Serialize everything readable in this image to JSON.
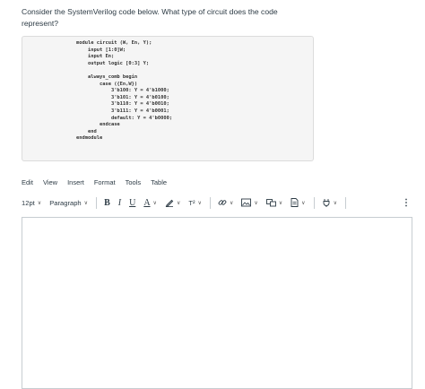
{
  "question": {
    "line1": "Consider the SystemVerilog code below. What type of circuit does the code",
    "line2": "represent?"
  },
  "code_lines": [
    "module circuit (W, En, Y);",
    "    input [1:0]W;",
    "    input En;",
    "    output logic [0:3] Y;",
    "",
    "    always_comb begin",
    "        case ({En,W})",
    "            3'b100: Y = 4'b1000;",
    "            3'b101: Y = 4'b0100;",
    "            3'b110: Y = 4'b0010;",
    "            3'b111: Y = 4'b0001;",
    "            default: Y = 4'b0000;",
    "        endcase",
    "    end",
    "endmodule"
  ],
  "menu": {
    "edit": "Edit",
    "view": "View",
    "insert": "Insert",
    "format": "Format",
    "tools": "Tools",
    "table": "Table"
  },
  "toolbar": {
    "font_size": "12pt",
    "paragraph": "Paragraph",
    "bold": "B",
    "italic": "I",
    "underline": "U",
    "text_color": "A",
    "superscript": "T²",
    "more": "⋮"
  },
  "icons": {
    "highlight": "pencil-icon",
    "link": "link-icon",
    "image": "image-icon",
    "embed": "embed-icon",
    "document": "document-icon",
    "plugin": "plug-icon"
  },
  "colors": {
    "text": "#2d3b45",
    "code_bg": "#f5f5f5",
    "border": "#c7cdd1"
  }
}
